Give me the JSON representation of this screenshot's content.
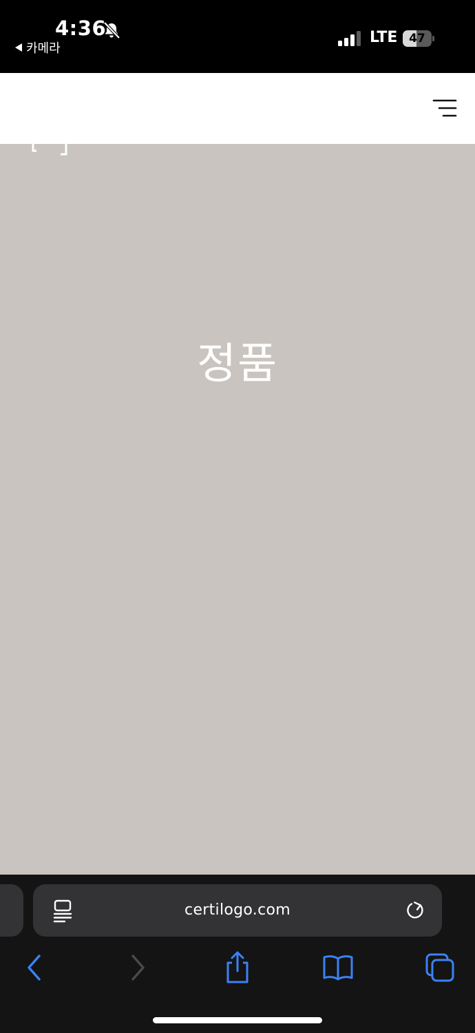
{
  "status_bar": {
    "time": "4:36",
    "back_app_label": "카메라",
    "network": "LTE",
    "battery_level": "47",
    "battery_fraction": 0.47
  },
  "header": {
    "menu_icon": "hamburger-menu-icon"
  },
  "content": {
    "hero_text": "정품",
    "background_color": "#c9c4bf"
  },
  "browser": {
    "url": "certilogo.com",
    "icons": {
      "reader": "reader-mode-icon",
      "reload": "reload-icon",
      "back": "chevron-left-icon",
      "forward": "chevron-right-icon",
      "share": "share-icon",
      "bookmarks": "book-icon",
      "tabs": "tabs-icon"
    },
    "accent_color": "#3b82f6"
  }
}
